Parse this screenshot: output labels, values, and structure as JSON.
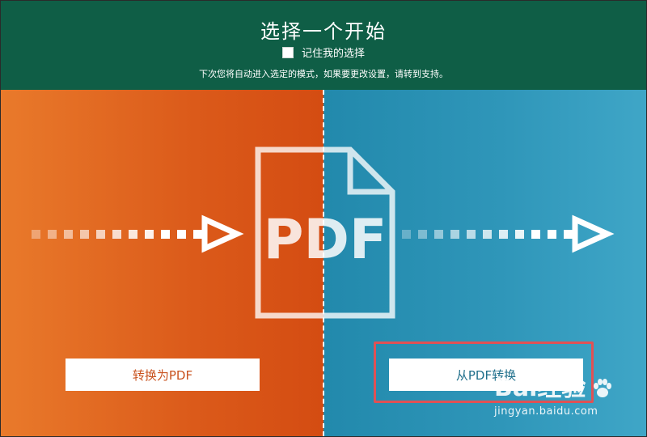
{
  "header": {
    "title": "选择一个开始",
    "remember_label": "记住我的选择",
    "note": "下次您将自动进入选定的模式，如果要更改设置，请转到支持。"
  },
  "graphic": {
    "pdf_text": "PDF"
  },
  "buttons": {
    "convert_to_pdf": "转换为PDF",
    "convert_from_pdf": "从PDF转换"
  },
  "watermark": {
    "brand": "Bai经验",
    "url": "jingyan.baidu.com"
  },
  "colors": {
    "header_bg": "#0f5e46",
    "left_panel": "#db5a1a",
    "right_panel": "#2f96b9",
    "highlight": "#e05155"
  }
}
